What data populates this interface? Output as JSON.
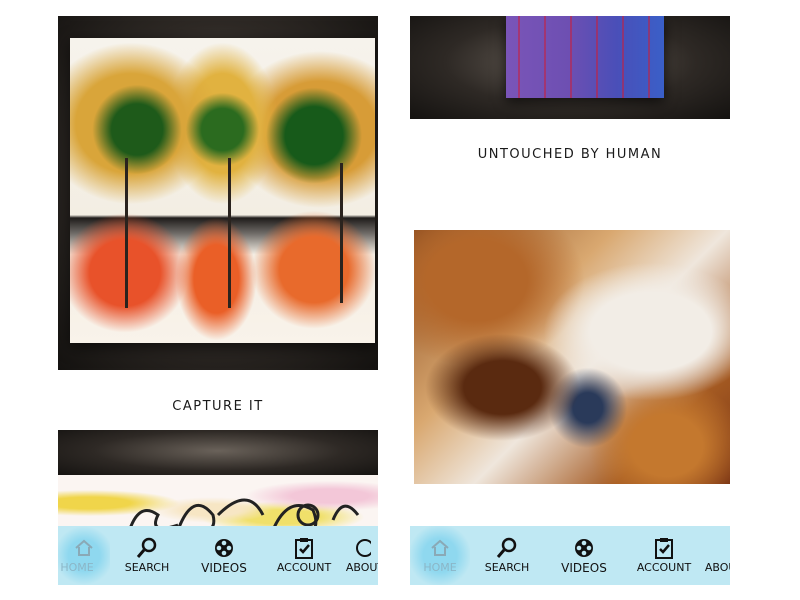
{
  "left_panel": {
    "caption": "CAPTURE IT",
    "tabs": [
      {
        "label": "HOME",
        "icon": "home-icon"
      },
      {
        "label": "SEARCH",
        "icon": "search-icon"
      },
      {
        "label": "VIDEOS",
        "icon": "film-reel-icon"
      },
      {
        "label": "ACCOUNT",
        "icon": "clipboard-check-icon"
      },
      {
        "label": "ABOUT",
        "icon": "info-icon"
      }
    ]
  },
  "right_panel": {
    "caption": "UNTOUCHED BY HUMAN",
    "tabs": [
      {
        "label": "HOME",
        "icon": "home-icon"
      },
      {
        "label": "SEARCH",
        "icon": "search-icon"
      },
      {
        "label": "VIDEOS",
        "icon": "film-reel-icon"
      },
      {
        "label": "ACCOUNT",
        "icon": "clipboard-check-icon"
      },
      {
        "label": "ABOUT",
        "icon": "info-icon"
      }
    ]
  },
  "colors": {
    "tabbar_bg": "#bfe8f3",
    "home_glow": "#8fd8ef",
    "caption_text": "#1a1a1a",
    "wall_dark": "#141210"
  }
}
